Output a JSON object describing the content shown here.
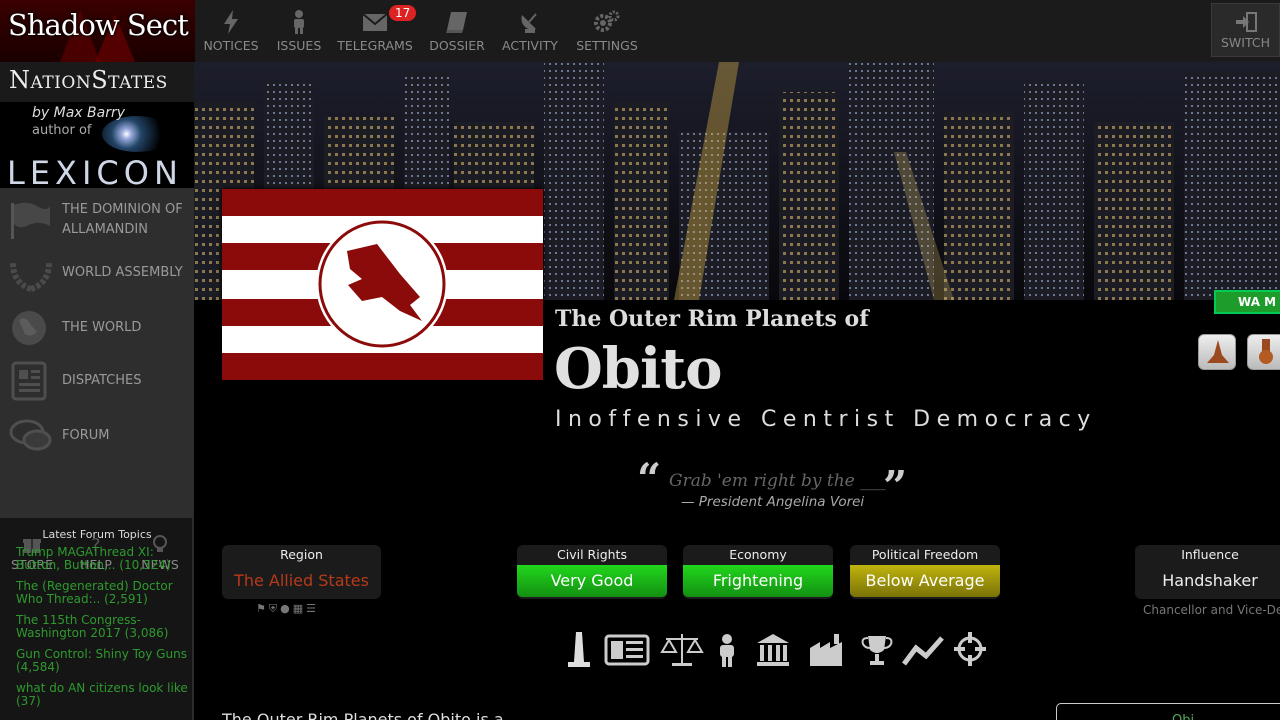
{
  "brand": {
    "title": "Shadow Sect"
  },
  "nav": [
    {
      "label": "NOTICES",
      "icon": "lightning-icon"
    },
    {
      "label": "ISSUES",
      "icon": "person-icon"
    },
    {
      "label": "TELEGRAMS",
      "icon": "envelope-icon",
      "badge": "17"
    },
    {
      "label": "DOSSIER",
      "icon": "book-icon"
    },
    {
      "label": "ACTIVITY",
      "icon": "satellite-dish-icon"
    },
    {
      "label": "SETTINGS",
      "icon": "gears-icon"
    }
  ],
  "switch": {
    "label": "SWITCH",
    "icon": "sign-in-icon"
  },
  "sidebar": {
    "logo": "NationStates",
    "lexicon": {
      "by": "by Max Barry",
      "author": "author of",
      "word": "LEXICON"
    },
    "items": [
      {
        "label": "THE DOMINION OF ALLAMANDIN",
        "icon": "flag-icon"
      },
      {
        "label": "WORLD ASSEMBLY",
        "icon": "wreath-icon"
      },
      {
        "label": "THE WORLD",
        "icon": "globe-icon"
      },
      {
        "label": "DISPATCHES",
        "icon": "newspaper-icon"
      },
      {
        "label": "FORUM",
        "icon": "speech-bubbles-icon"
      }
    ],
    "mini": [
      {
        "label": "STORE",
        "icon": "gift-icon"
      },
      {
        "label": "HELP",
        "icon": "question-icon"
      },
      {
        "label": "NEWS",
        "icon": "lightbulb-icon"
      }
    ],
    "forum": {
      "header": "Latest Forum Topics",
      "topics": [
        "Trump MAGAThread XI: Button, Button,.. (10,324)",
        "The (Regenerated) Doctor Who Thread:.. (2,591)",
        "The 115th Congress- Washington 2017 (3,086)",
        "Gun Control: Shiny Toy Guns (4,584)",
        "what do AN citizens look like (37)"
      ]
    }
  },
  "banner": {
    "wa_tab": "WA M"
  },
  "nation": {
    "pretitle": "The Outer Rim Planets of",
    "name": "Obito",
    "category": "Inoffensive Centrist Democracy",
    "motto": "Grab 'em right by the ___",
    "leader": "— President Angelina Vorei"
  },
  "stats": {
    "region": {
      "header": "Region",
      "value": "The Allied States"
    },
    "civil_rights": {
      "header": "Civil Rights",
      "value": "Very Good"
    },
    "economy": {
      "header": "Economy",
      "value": "Frightening"
    },
    "political_freedom": {
      "header": "Political Freedom",
      "value": "Below Average"
    },
    "influence": {
      "header": "Influence",
      "value": "Handshaker",
      "sub": "Chancellor and Vice-De"
    }
  },
  "iconrow": [
    "monument-icon",
    "newspaper-icon",
    "scales-icon",
    "person-icon",
    "bank-icon",
    "factory-icon",
    "trophy-icon",
    "trend-icon",
    "crosshair-icon"
  ],
  "blurb": "The Outer Rim Planets of Obito is a...",
  "rightbox": "Obi",
  "colors": {
    "accent_green": "#1fc41b",
    "region_red": "#b73a1b",
    "flag_red": "#8b0b0b"
  }
}
